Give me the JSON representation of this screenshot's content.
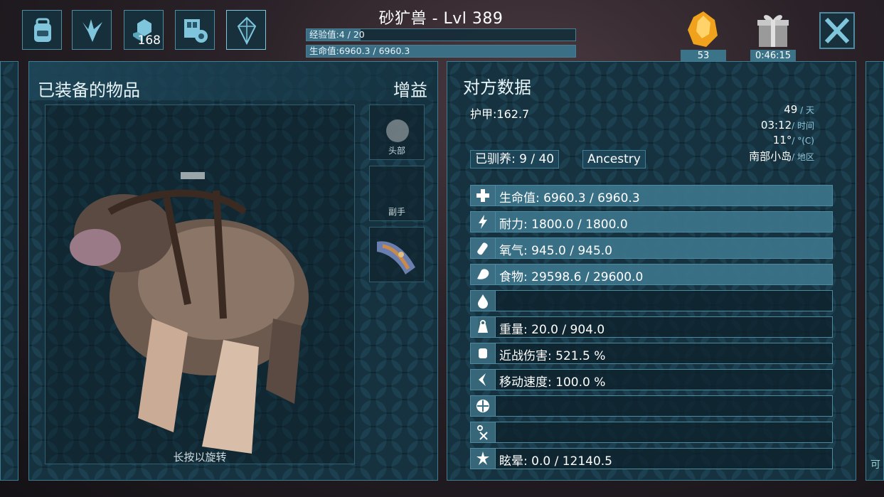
{
  "header": {
    "title": "砂犷兽 - Lvl 389",
    "xp_label": "经验值:4 / 20",
    "xp_fraction": 0.2,
    "health_label": "生命值:6960.3 / 6960.3",
    "health_fraction": 1.0
  },
  "top_buttons": [
    {
      "icon": "backpack-icon"
    },
    {
      "icon": "dino-footprint-icon"
    },
    {
      "icon": "engrams-icon",
      "count": "168"
    },
    {
      "icon": "settings-icon"
    },
    {
      "icon": "crystal-icon"
    }
  ],
  "resources": {
    "amber_count": "53",
    "gift_timer": "0:46:15"
  },
  "left_panel": {
    "title": "已装备的物品",
    "buff_label": "增益",
    "slots": {
      "head": "头部",
      "offhand": "副手"
    },
    "rotate_hint": "长按以旋转"
  },
  "right_panel": {
    "title": "对方数据",
    "armor": "护甲:162.7",
    "tamed_label": "已驯养: 9 / 40",
    "ancestry_label": "Ancestry",
    "env": {
      "day_value": "49",
      "day_unit": " / 天",
      "time_value": "03:12",
      "time_unit": "/ 时间",
      "temp_value": "11°",
      "temp_unit": "/ °(C)",
      "region_value": "南部小岛",
      "region_unit": "/ 地区"
    },
    "stats": [
      {
        "icon": "health-cross-icon",
        "label": "生命值: 6960.3 / 6960.3",
        "fraction": 1.0
      },
      {
        "icon": "stamina-bolt-icon",
        "label": "耐力: 1800.0 / 1800.0",
        "fraction": 1.0
      },
      {
        "icon": "oxygen-tank-icon",
        "label": "氧气: 945.0 / 945.0",
        "fraction": 1.0
      },
      {
        "icon": "food-drumstick-icon",
        "label": "食物: 29598.6 / 29600.0",
        "fraction": 1.0
      },
      {
        "icon": "water-drop-icon",
        "label": "",
        "fraction": 0.0
      },
      {
        "icon": "weight-icon",
        "label": "重量: 20.0 / 904.0",
        "fraction": 0.02
      },
      {
        "icon": "melee-fist-icon",
        "label": "近战伤害: 521.5 %",
        "fraction": 0.0
      },
      {
        "icon": "speed-icon",
        "label": "移动速度: 100.0 %",
        "fraction": 0.0
      },
      {
        "icon": "fortitude-icon",
        "label": "",
        "fraction": 0.0
      },
      {
        "icon": "crafting-icon",
        "label": "",
        "fraction": 0.0
      },
      {
        "icon": "torpor-icon",
        "label": "眩晕: 0.0 / 12140.5",
        "fraction": 0.0
      }
    ]
  },
  "right_edge_label": "可"
}
